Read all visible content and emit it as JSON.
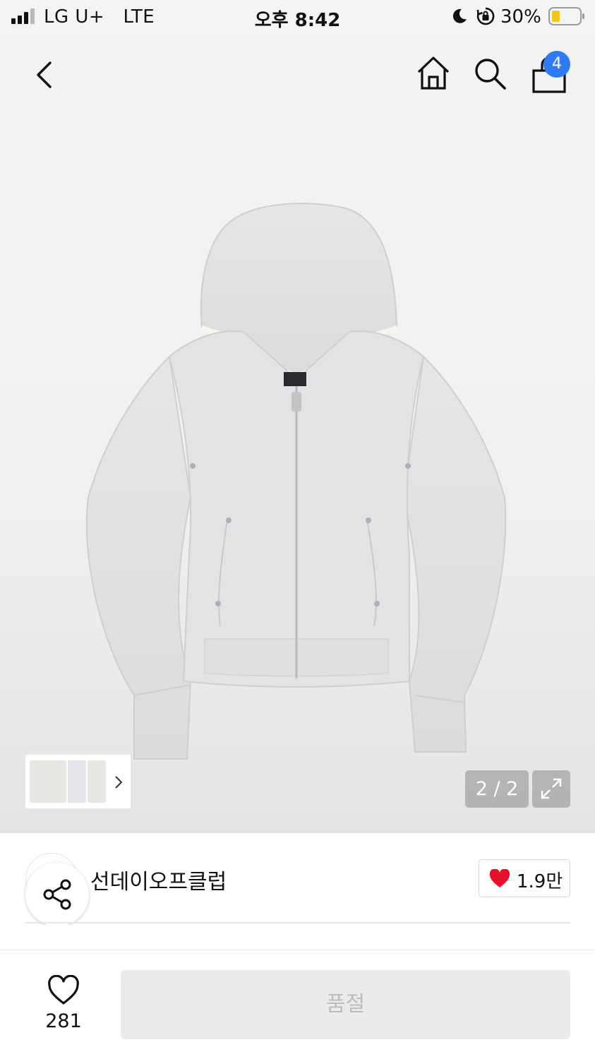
{
  "status_bar": {
    "carrier": "LG U+",
    "network": "LTE",
    "time": "오후 8:42",
    "battery_percent": "30%"
  },
  "top_nav": {
    "back_icon": "chevron-left-icon",
    "home_icon": "home-icon",
    "search_icon": "search-icon",
    "bag_icon": "shopping-bag-icon",
    "cart_count": "4",
    "badge_color": "#2f7bf5"
  },
  "gallery": {
    "counter": "2 / 2",
    "thumbnail_count": 3,
    "expand_icon": "expand-icon",
    "image": "light-gray zip-up hoodie"
  },
  "brand": {
    "name": "선데이오프클럽",
    "likes": "1.9만",
    "like_icon_color": "#e8102a",
    "share_icon": "share-icon"
  },
  "bottom_bar": {
    "wish_count": "281",
    "wish_icon": "heart-outline-icon",
    "cta_label": "품절"
  }
}
